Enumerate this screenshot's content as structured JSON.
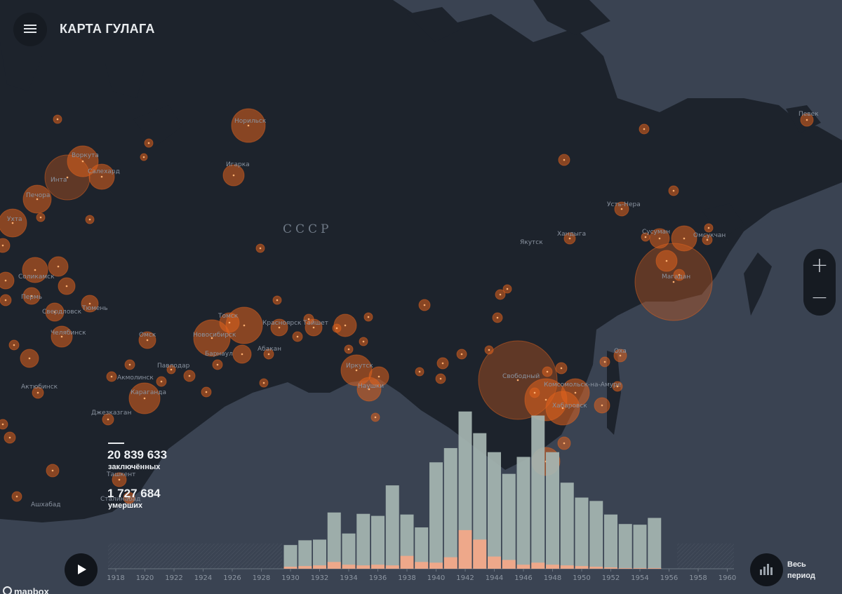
{
  "header": {
    "title": "КАРТА ГУЛАГА"
  },
  "map": {
    "country_label": "СССР",
    "places": [
      "Норильск",
      "Игарка",
      "Воркута",
      "Салехард",
      "Инта",
      "Печора",
      "Ухта",
      "Соликамск",
      "Пермь",
      "Свердловск",
      "Тюмень",
      "Челябинск",
      "Омск",
      "Новосибирск",
      "Томск",
      "Барнаул",
      "Красноярск",
      "Тайшет",
      "Абакан",
      "Иркутск",
      "Наушки",
      "Павлодар",
      "Акмолинск",
      "Караганда",
      "Актюбинск",
      "Джезказган",
      "Ташкент",
      "Сталинабад",
      "Ашхабад",
      "Якутск",
      "Хандыга",
      "Усть-Нера",
      "Сусуман",
      "Омсукчан",
      "Магадан",
      "Свободный",
      "Комсомольск-на-Амуре",
      "Хабаровск",
      "Оха",
      "Певек"
    ],
    "marker_color": "#e0621d",
    "land_color": "#1d232c",
    "water_color": "#3a4352"
  },
  "stats": {
    "prisoners_value": "20 839 633",
    "prisoners_label": "заключённых",
    "deaths_value": "1 727 684",
    "deaths_label": "умерших"
  },
  "chart_data": {
    "type": "bar",
    "title": "",
    "xlabel": "",
    "ylabel": "",
    "categories": [
      "1930",
      "1931",
      "1932",
      "1933",
      "1934",
      "1935",
      "1936",
      "1937",
      "1938",
      "1939",
      "1940",
      "1941",
      "1942",
      "1943",
      "1944",
      "1945",
      "1946",
      "1947",
      "1948",
      "1949",
      "1950",
      "1951",
      "1952",
      "1953",
      "1954",
      "1955",
      "1956"
    ],
    "x_ticks": [
      "1918",
      "1920",
      "1922",
      "1924",
      "1926",
      "1928",
      "1930",
      "1932",
      "1934",
      "1936",
      "1938",
      "1940",
      "1942",
      "1944",
      "1946",
      "1948",
      "1950",
      "1952",
      "1954",
      "1956",
      "1958",
      "1960"
    ],
    "x_range": [
      1917,
      1961
    ],
    "series": [
      {
        "values": [
          35,
          42,
          43,
          83,
          52,
          81,
          78,
          123,
          80,
          61,
          157,
          178,
          232,
          200,
          172,
          140,
          165,
          226,
          172,
          127,
          105,
          100,
          80,
          66,
          65,
          75
        ],
        "color": "#a6b6b2"
      },
      {
        "values": [
          3,
          4,
          5,
          10,
          6,
          5,
          6,
          5,
          19,
          10,
          9,
          17,
          57,
          43,
          18,
          13,
          6,
          9,
          6,
          5,
          4,
          3,
          2,
          1,
          1,
          1
        ],
        "color": "#eea88a"
      }
    ],
    "ylim": [
      0,
      240
    ],
    "grid": false,
    "legend": "none"
  },
  "controls": {
    "period_label": "Весь период",
    "zoom_in": "+",
    "zoom_out": "−",
    "attribution": "mapbox"
  }
}
